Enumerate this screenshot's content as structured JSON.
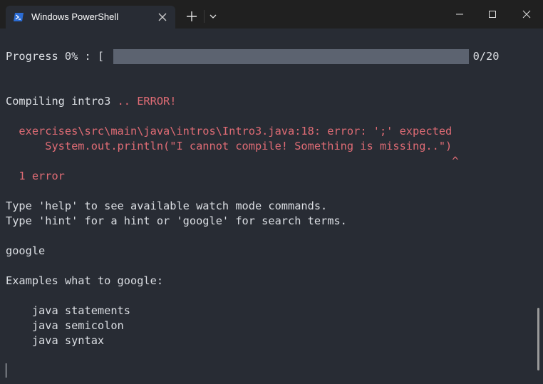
{
  "titlebar": {
    "tab_title": "Windows PowerShell",
    "tab_icon": "powershell-icon",
    "close_icon": "close-icon",
    "new_tab_icon": "plus-icon",
    "dropdown_icon": "chevron-down-icon",
    "minimize_icon": "minimize-icon",
    "maximize_icon": "maximize-icon",
    "window_close_icon": "close-icon"
  },
  "colors": {
    "background": "#282c34",
    "titlebar": "#202020",
    "text": "#dcdfe4",
    "error": "#e06c75",
    "progress_bar": "#5c6370",
    "icon_blue": "#2b6cd4"
  },
  "terminal": {
    "progress_prefix": "Progress 0% : [",
    "progress_suffix": "] 0/20",
    "progress_fraction": 0,
    "compiling": "Compiling intro3 ",
    "compiling_status": ".. ERROR!",
    "error_path": "  exercises\\src\\main\\java\\intros\\Intro3.java:18: error: ';' expected",
    "error_source": "      System.out.println(\"I cannot compile! Something is missing..\")",
    "error_caret": "                                                                    ^",
    "error_count": "  1 error",
    "help_line": "Type 'help' to see available watch mode commands.",
    "hint_line": "Type 'hint' for a hint or 'google' for search terms.",
    "command": "google",
    "examples_heading": "Examples what to google:",
    "examples": [
      "    java statements",
      "    java semicolon",
      "    java syntax"
    ]
  }
}
